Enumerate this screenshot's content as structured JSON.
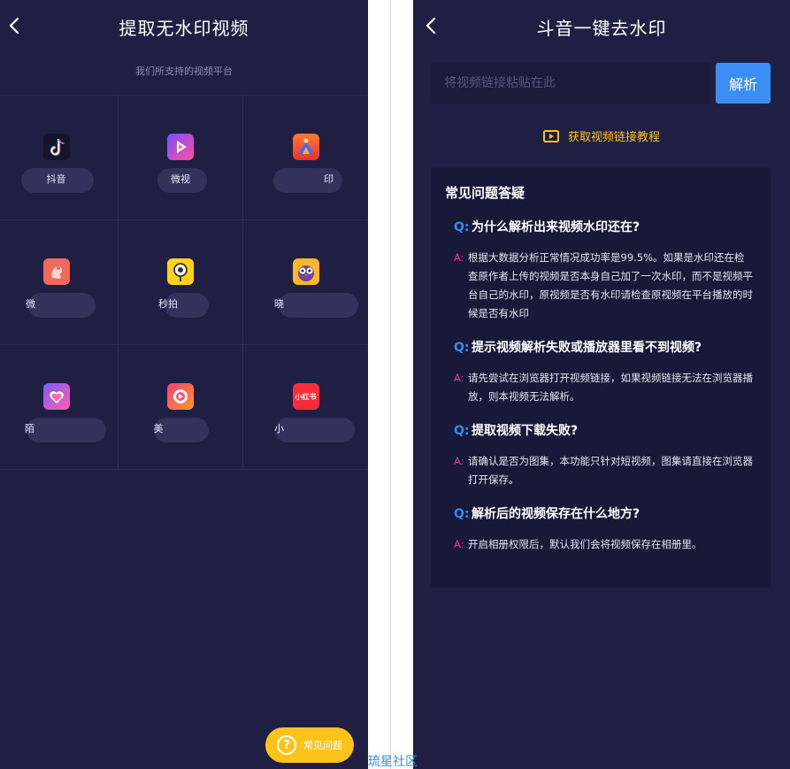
{
  "left": {
    "header": {
      "title": "提取无水印视频"
    },
    "subtitle": "我们所支持的视频平台",
    "platforms": [
      {
        "name": "抖音",
        "icon": "douyin-icon"
      },
      {
        "name": "微视",
        "icon": "weishi-icon"
      },
      {
        "name": "印",
        "icon": "volcano-icon"
      },
      {
        "name": "微",
        "icon": "pink-figure-icon"
      },
      {
        "name": "秒拍",
        "icon": "miaopai-icon"
      },
      {
        "name": "晓",
        "icon": "owl-icon"
      },
      {
        "name": "陌",
        "icon": "heart-icon"
      },
      {
        "name": "美",
        "icon": "meipai-icon"
      },
      {
        "name": "小",
        "icon": "xiaohongshu-icon"
      }
    ],
    "xhs_icon_text": "小红书",
    "help_button": {
      "label": "常见问题"
    }
  },
  "right": {
    "header": {
      "title": "斗音一键去水印"
    },
    "input": {
      "placeholder": "将视频链接粘贴在此",
      "value": ""
    },
    "parse_button": {
      "label": "解析"
    },
    "tutorial": {
      "label": "获取视频链接教程"
    },
    "faq": {
      "title": "常见问题答疑",
      "q_mark": "Q:",
      "a_mark": "A:",
      "items": [
        {
          "question": "为什么解析出来视频水印还在?",
          "answer": "根据大数据分析正常情况成功率是99.5%。如果是水印还在检查原作者上传的视频是否本身自己加了一次水印，而不是视频平台自己的水印，原视频是否有水印请检查原视频在平台播放的时候是否有水印"
        },
        {
          "question": "提示视频解析失败或播放器里看不到视频?",
          "answer": "请先尝试在浏览器打开视频链接，如果视频链接无法在浏览器播放，则本视频无法解析。"
        },
        {
          "question": "提取视频下载失败?",
          "answer": "请确认是否为图集，本功能只针对短视频，图集请直接在浏览器打开保存。"
        },
        {
          "question": "解析后的视频保存在什么地方?",
          "answer": "开启相册权限后，默认我们会将视频保存在相册里。"
        }
      ]
    }
  },
  "watermark": "琉星社区",
  "colors": {
    "background": "#1f1f43",
    "card": "#181838",
    "accent_blue": "#3a8ef6",
    "accent_yellow": "#ffc21a",
    "a_mark": "#e23a9a"
  }
}
